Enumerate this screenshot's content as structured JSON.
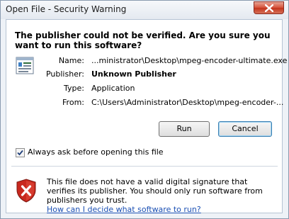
{
  "window": {
    "title": "Open File - Security Warning"
  },
  "headline": "The publisher could not be verified.  Are you sure you want to run this software?",
  "details": [
    {
      "label": "Name:",
      "value": "...ministrator\\Desktop\\mpeg-encoder-ultimate.exe"
    },
    {
      "label": "Publisher:",
      "value": "Unknown Publisher"
    },
    {
      "label": "Type:",
      "value": "Application"
    },
    {
      "label": "From:",
      "value": "C:\\Users\\Administrator\\Desktop\\mpeg-encoder-..."
    }
  ],
  "buttons": {
    "run_label": "Run",
    "cancel_label": "Cancel"
  },
  "checkbox": {
    "label": "Always ask before opening this file",
    "checked": true
  },
  "warning": {
    "text": "This file does not have a valid digital signature that verifies its publisher.  You should only run software from publishers you trust.",
    "link": "How can I decide what software to run?"
  },
  "icons": {
    "close": "close-icon",
    "document": "document-icon",
    "shield": "shield-error-icon",
    "check": "check-icon"
  }
}
